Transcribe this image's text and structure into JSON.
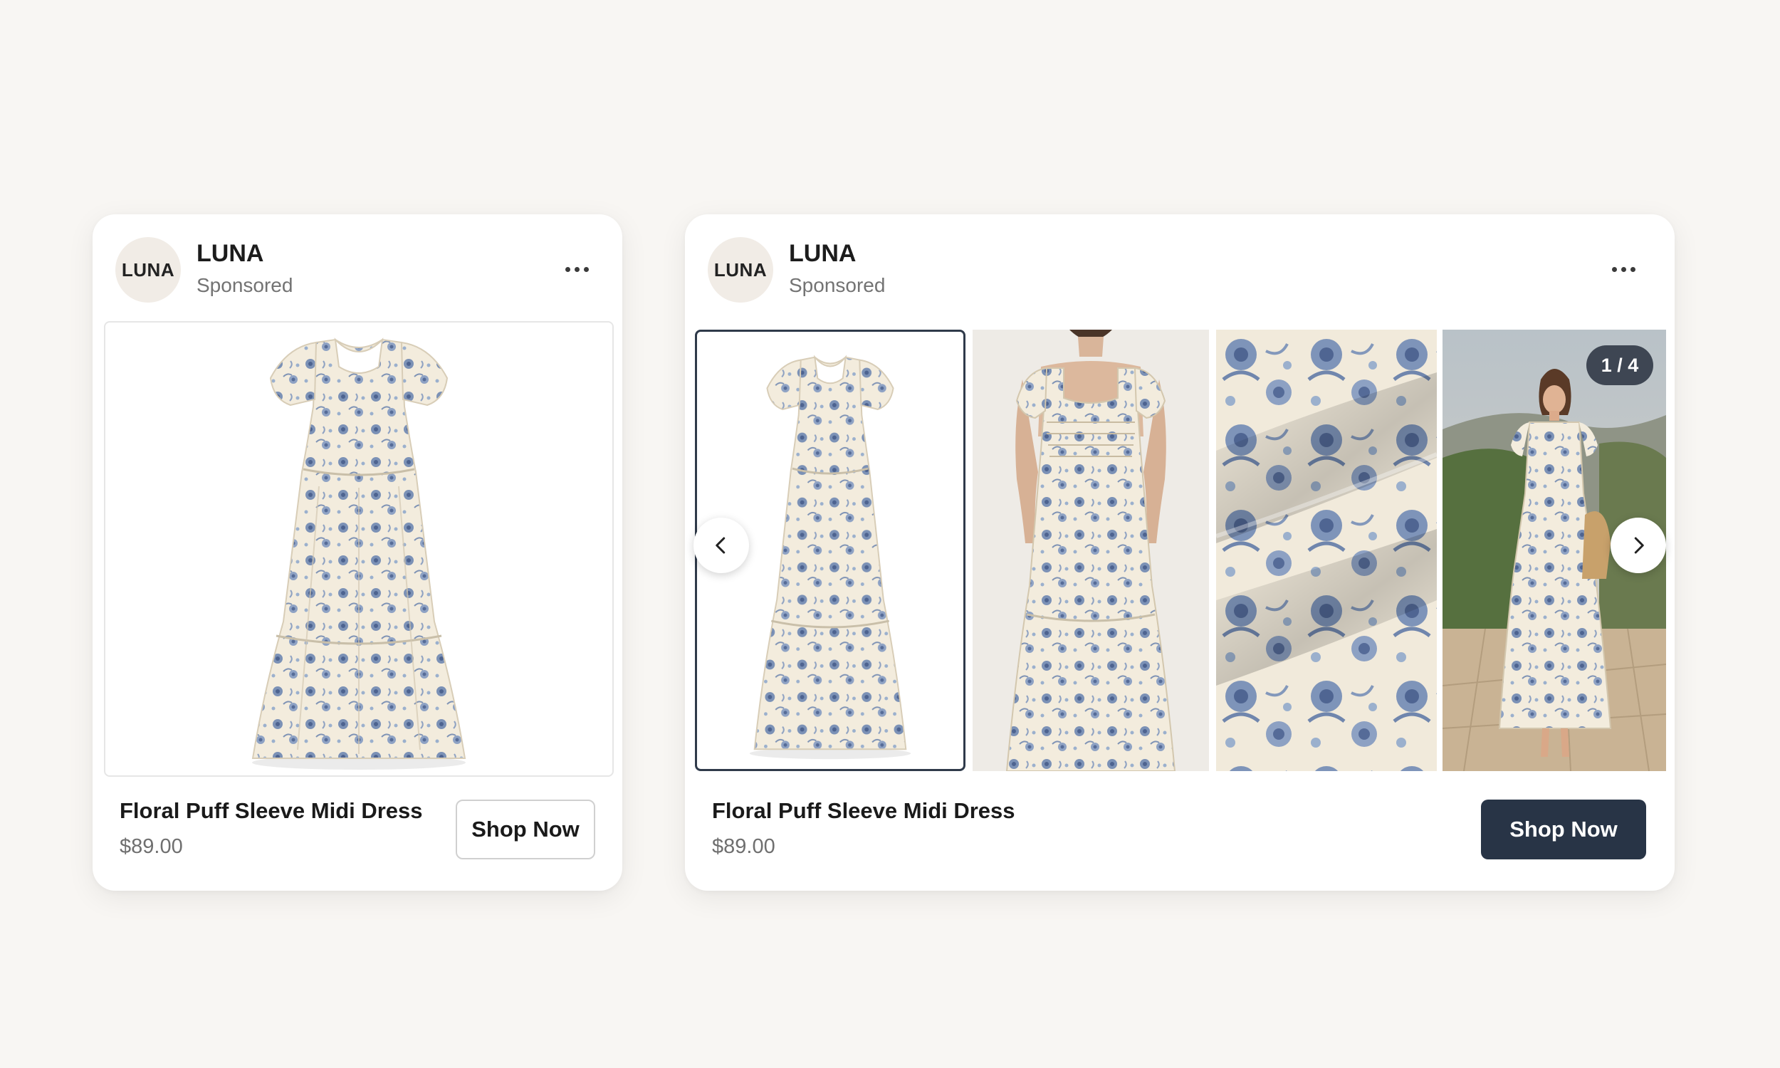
{
  "ads": [
    {
      "brand": {
        "avatar_text": "LUNA",
        "name": "LUNA",
        "label": "Sponsored"
      },
      "product": {
        "title": "Floral Puff Sleeve Midi Dress",
        "price": "$89.00"
      },
      "cta": "Shop Now"
    },
    {
      "brand": {
        "avatar_text": "LUNA",
        "name": "LUNA",
        "label": "Sponsored"
      },
      "product": {
        "title": "Floral Puff Sleeve Midi Dress",
        "price": "$89.00"
      },
      "cta": "Shop Now",
      "carousel": {
        "counter": "1 / 4",
        "current": 1,
        "total": 4
      }
    }
  ],
  "icons": {
    "more": "more-horizontal-icon",
    "prev": "chevron-left-icon",
    "next": "chevron-right-icon"
  },
  "colors": {
    "page_bg": "#f8f6f3",
    "cta_solid": "#283446",
    "dress_cream": "#f3ecdd",
    "floral_blue": "#6c83aa"
  }
}
